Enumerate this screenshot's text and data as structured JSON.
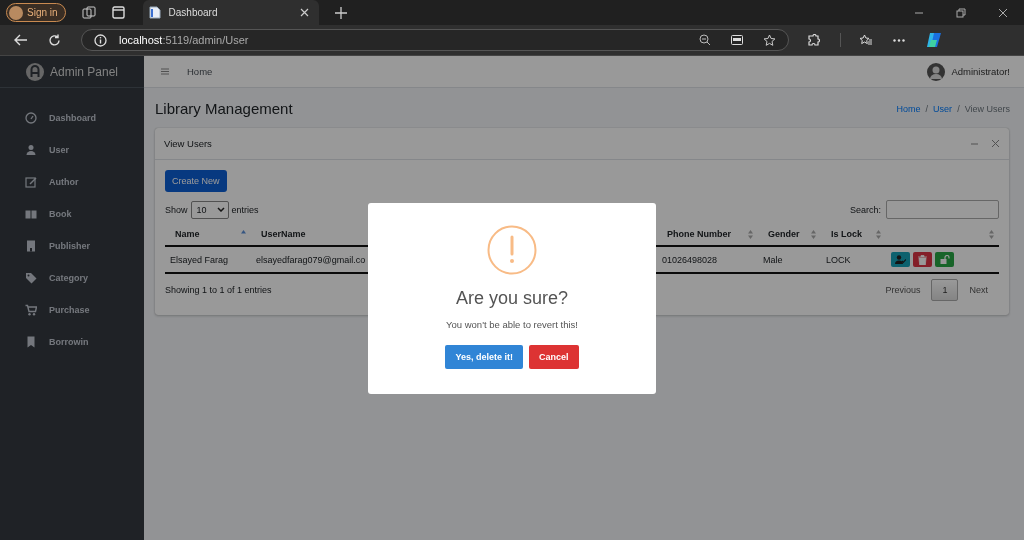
{
  "browser": {
    "profile_button": "Sign in",
    "tab_title": "Dashboard",
    "url_host": "localhost",
    "url_path": ":5119/admin/User"
  },
  "sidebar": {
    "brand": "Admin Panel",
    "items": [
      {
        "label": "Dashboard",
        "kind": "dashboard"
      },
      {
        "label": "User",
        "kind": "user"
      },
      {
        "label": "Author",
        "kind": "edit"
      },
      {
        "label": "Book",
        "kind": "book"
      },
      {
        "label": "Publisher",
        "kind": "building"
      },
      {
        "label": "Category",
        "kind": "tag"
      },
      {
        "label": "Purchase",
        "kind": "cart"
      },
      {
        "label": "Borrowin",
        "kind": "bookmark"
      }
    ]
  },
  "navbar": {
    "link": "Home",
    "user": "Administrator!"
  },
  "page": {
    "title": "Library Management",
    "separator": "/",
    "breadcrumb": [
      {
        "label": "Home",
        "active": false
      },
      {
        "label": "User",
        "active": false
      },
      {
        "label": "View Users",
        "active": true
      }
    ]
  },
  "card": {
    "title": "View Users",
    "create_button": "Create New",
    "show_label": "Show",
    "page_length": "10",
    "entries_label": "entries",
    "search_label": "Search:",
    "columns": [
      {
        "label": "Name",
        "sorted": true
      },
      {
        "label": "UserName"
      },
      {
        "label": "Phone Number",
        "sorted": false
      },
      {
        "label": "Gender",
        "sorted": false
      },
      {
        "label": "Is Lock",
        "sorted": false
      },
      {
        "sorted": false
      }
    ],
    "rows": [
      {
        "cells": [
          "Elsayed Farag",
          "elsayedfarag079@gmail.co",
          "01026498028",
          "Male",
          "LOCK"
        ],
        "actions": [
          {
            "kind": "edit"
          },
          {
            "kind": "delete"
          },
          {
            "kind": "unlock"
          }
        ]
      }
    ],
    "info": "Showing 1 to 1 of 1 entries",
    "pagination": [
      {
        "label": "Previous",
        "selected": false
      },
      {
        "label": "1",
        "selected": true
      },
      {
        "label": "Next",
        "selected": false
      }
    ]
  },
  "dialog": {
    "title": "Are you sure?",
    "text": "You won't be able to revert this!",
    "confirm": "Yes, delete it!",
    "cancel": "Cancel"
  }
}
